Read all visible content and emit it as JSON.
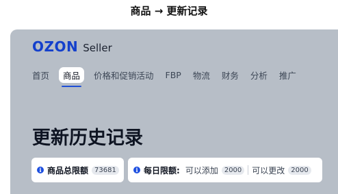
{
  "caption": "商品 → 更新记录",
  "brand": {
    "logo": "OZON",
    "product": "Seller",
    "logo_color": "#1440cc"
  },
  "nav": {
    "items": [
      {
        "label": "首页"
      },
      {
        "label": "商品",
        "active": true
      },
      {
        "label": "价格和促销活动"
      },
      {
        "label": "FBP"
      },
      {
        "label": "物流"
      },
      {
        "label": "财务"
      },
      {
        "label": "分析"
      },
      {
        "label": "推广"
      }
    ]
  },
  "page": {
    "title": "更新历史记录"
  },
  "limits": {
    "total": {
      "label": "商品总限额",
      "value": "73681"
    },
    "daily": {
      "label": "每日限额:",
      "add_label": "可以添加",
      "add_value": "2000",
      "change_label": "可以更改",
      "change_value": "2000"
    }
  },
  "colors": {
    "accent": "#1d4fe0",
    "frame_bg": "#b7bec7"
  }
}
